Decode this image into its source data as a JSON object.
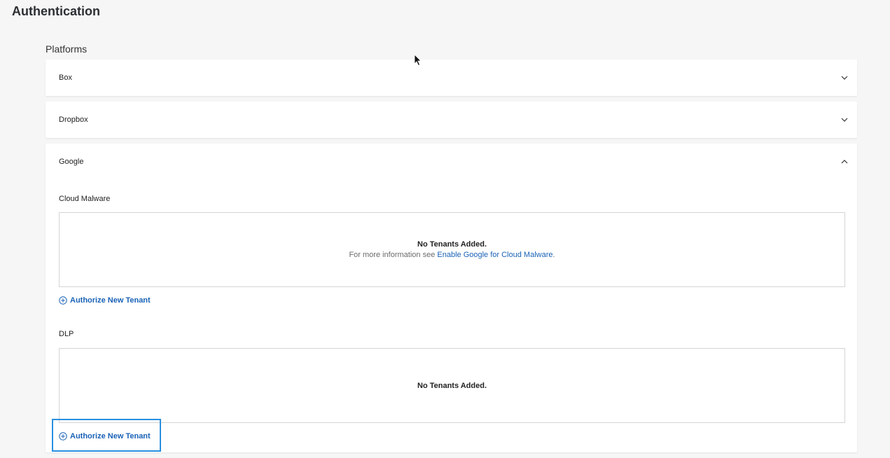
{
  "page": {
    "title": "Authentication"
  },
  "platforms": {
    "title": "Platforms",
    "items": [
      {
        "label": "Box",
        "expanded": false
      },
      {
        "label": "Dropbox",
        "expanded": false
      },
      {
        "label": "Google",
        "expanded": true
      }
    ]
  },
  "google": {
    "cloud_malware": {
      "label": "Cloud Malware",
      "empty_title": "No Tenants Added.",
      "info_prefix": "For more information see",
      "info_link": "Enable Google for Cloud Malware",
      "info_suffix": ".",
      "authorize_label": "Authorize New Tenant"
    },
    "dlp": {
      "label": "DLP",
      "empty_title": "No Tenants Added.",
      "authorize_label": "Authorize New Tenant"
    }
  },
  "colors": {
    "accent": "#1a62b6",
    "highlight": "#2a8fe0",
    "background": "#f6f6f6"
  }
}
